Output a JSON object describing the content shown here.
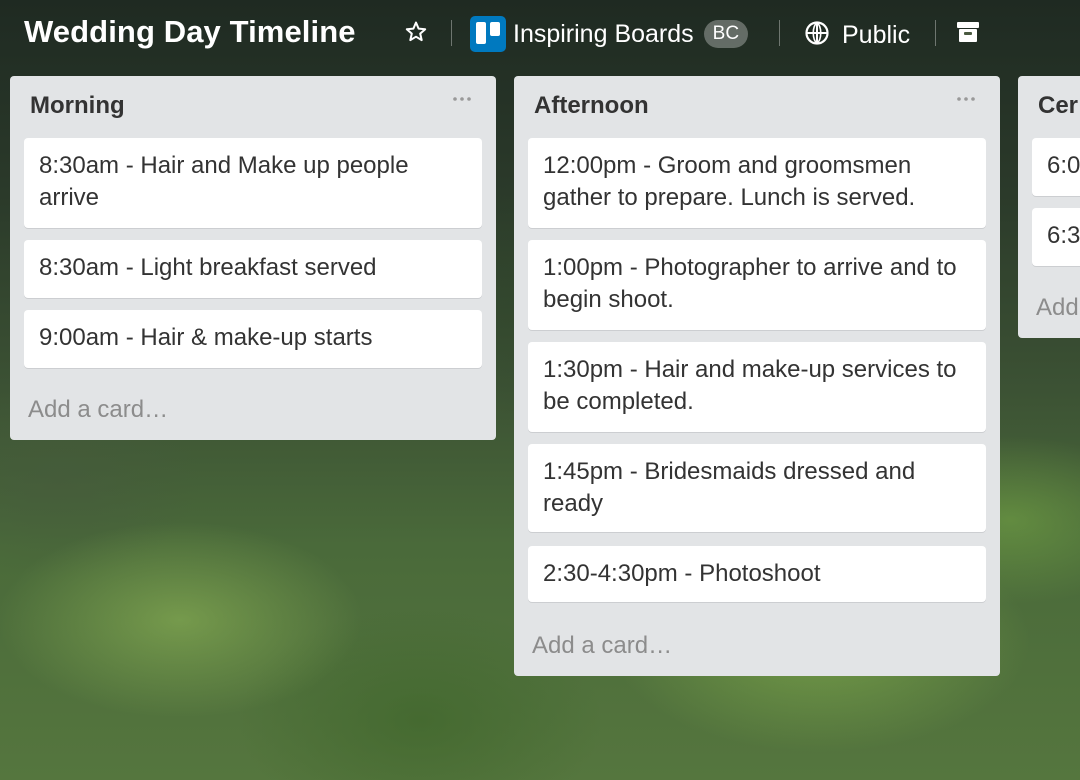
{
  "board": {
    "title": "Wedding Day Timeline",
    "team_name": "Inspiring Boards",
    "team_badge": "BC",
    "visibility": "Public",
    "icons": {
      "star": "star-icon",
      "team_logo": "trello-logo-icon",
      "visibility": "globe-icon",
      "archive": "archive-icon",
      "list_menu": "ellipsis-icon"
    }
  },
  "lists": [
    {
      "title": "Morning",
      "cards": [
        "8:30am - Hair and Make up people arrive",
        "8:30am - Light breakfast served",
        "9:00am - Hair & make-up starts"
      ],
      "add_card": "Add a card…"
    },
    {
      "title": "Afternoon",
      "cards": [
        "12:00pm - Groom and groomsmen gather to prepare. Lunch is served.",
        "1:00pm - Photographer to arrive and to begin shoot.",
        "1:30pm - Hair and make-up services to be completed.",
        "1:45pm - Bridesmaids dressed and ready",
        "2:30-4:30pm - Photoshoot"
      ],
      "add_card": "Add a card…"
    },
    {
      "title": "Cer",
      "cards": [
        "6:0",
        "6:3"
      ],
      "add_card": "Add"
    }
  ],
  "colors": {
    "list_bg": "#e2e4e6",
    "card_bg": "#ffffff",
    "text": "#333333",
    "muted": "#8c8c8c",
    "trello_blue": "#0079bf"
  }
}
